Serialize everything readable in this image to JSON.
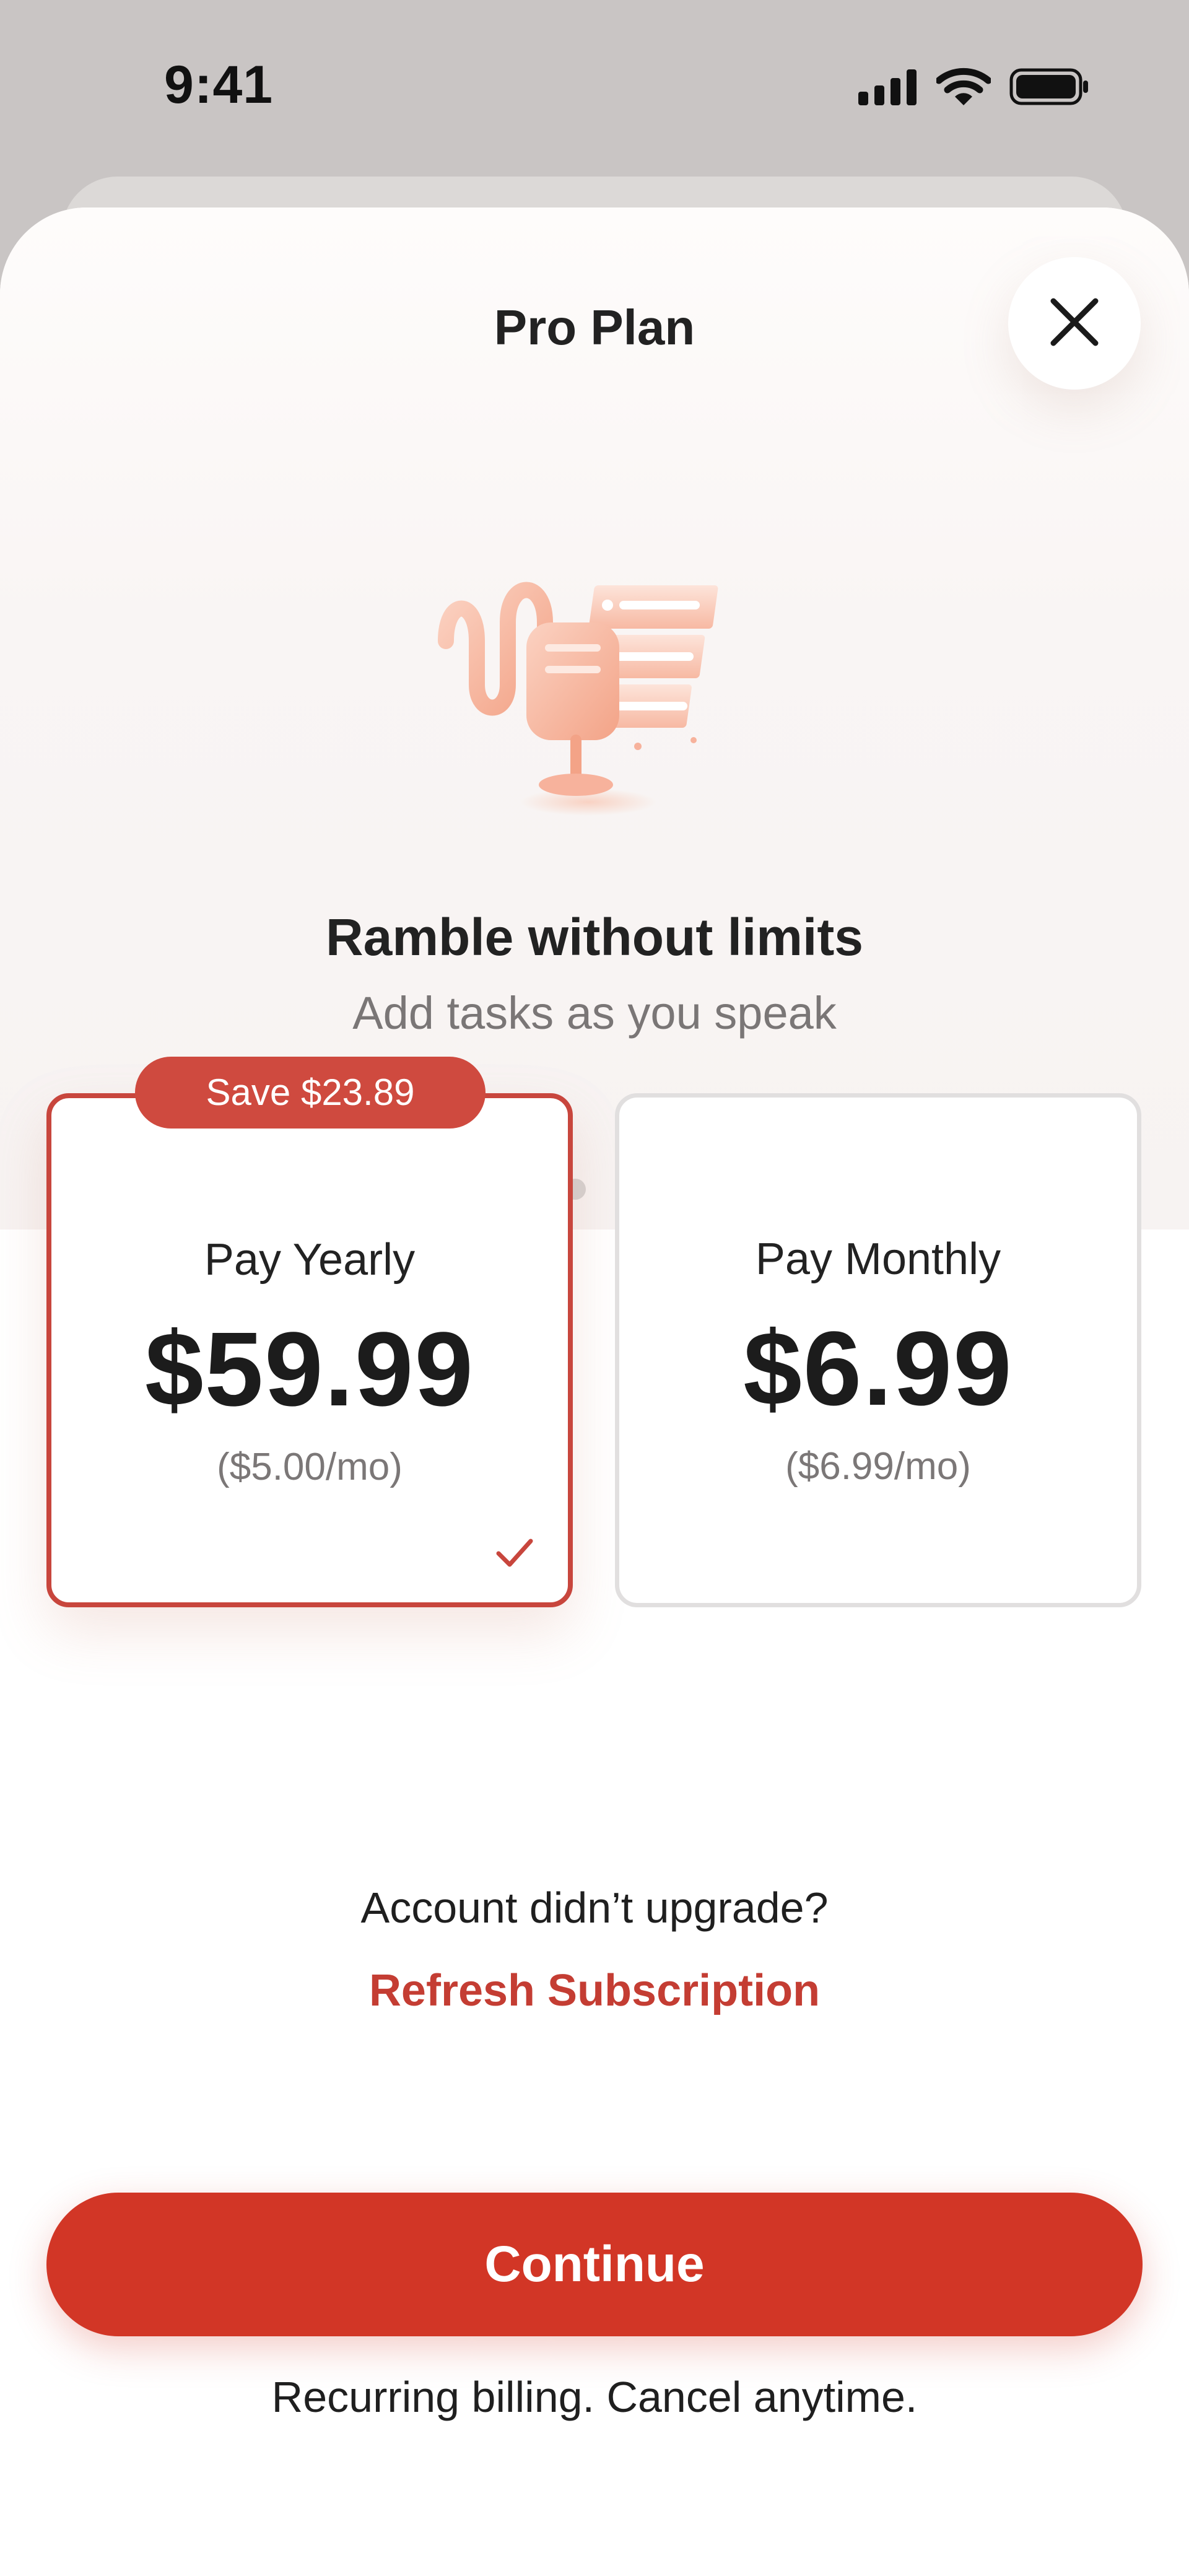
{
  "status_bar": {
    "time": "9:41",
    "icons": [
      "cellular-signal-icon",
      "wifi-icon",
      "battery-icon"
    ]
  },
  "sheet": {
    "title": "Pro Plan",
    "close_icon": "close-icon"
  },
  "feature": {
    "illustration": "microphone-tasks-illustration",
    "title": "Ramble without limits",
    "subtitle": "Add tasks as you speak",
    "page_count": 10,
    "active_page": 1
  },
  "plans": [
    {
      "badge": "Save $23.89",
      "name": "Pay Yearly",
      "price": "$59.99",
      "per_month": "($5.00/mo)",
      "selected": true
    },
    {
      "badge": "",
      "name": "Pay Monthly",
      "price": "$6.99",
      "per_month": "($6.99/mo)",
      "selected": false
    }
  ],
  "upgrade": {
    "question": "Account didn’t upgrade?",
    "refresh_label": "Refresh Subscription"
  },
  "footer": {
    "continue_label": "Continue",
    "billing_note": "Recurring billing. Cancel anytime."
  },
  "colors": {
    "accent": "#d23626",
    "selected_border": "#c8463d",
    "badge": "#cf4a3f",
    "link": "#c43d33"
  }
}
